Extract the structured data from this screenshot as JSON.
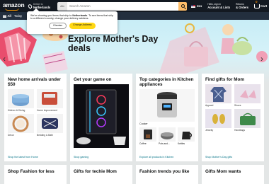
{
  "nav": {
    "logo": "amazon",
    "deliver_line1": "Deliver to",
    "deliver_line2": "Netherlands",
    "search_category": "All",
    "search_placeholder": "Search Amazon",
    "language": "EN",
    "account_line1": "Hello, sign in",
    "account_line2": "Account & Lists",
    "orders_line1": "Returns",
    "orders_line2": "& Orders",
    "cart_count": "0",
    "cart_label": "Cart"
  },
  "subnav": {
    "menu_label": "All",
    "items": [
      "Today"
    ]
  },
  "popup": {
    "message_pre": "We're showing you items that ship to ",
    "country": "Netherlands",
    "message_post": ". To see items that ship to a different country, change your delivery address.",
    "dismiss_label": "Dismiss",
    "change_label": "Change Address"
  },
  "hero": {
    "title": "Explore Mother's Day deals"
  },
  "cards": [
    {
      "title": "New home arrivals under $50",
      "tiles": [
        "Kitchen & Dining",
        "Home Improvement",
        "Décor",
        "Bedding & Bath"
      ],
      "link": "Shop the latest from Home"
    },
    {
      "title": "Get your game on",
      "link": "Shop gaming"
    },
    {
      "title": "Top categories in Kitchen appliances",
      "main_caption": "Cooker",
      "tiles": [
        "Coffee",
        "Pots and...",
        "Kettles"
      ],
      "link": "Explore all products in Kitchen"
    },
    {
      "title": "Find gifts for Mom",
      "tiles": [
        "Apparel",
        "Shoes",
        "Jewelry",
        "Handbags"
      ],
      "link": "Shop Mother's Day gifts"
    }
  ],
  "cards_row2": [
    {
      "title": "Shop Fashion for less"
    },
    {
      "title": "Gifts for techie Mom"
    },
    {
      "title": "Fashion trends you like"
    },
    {
      "title": "Gifts Mom wants"
    }
  ],
  "colors": {
    "nav_bg": "#131921",
    "subnav_bg": "#232f3e",
    "accent": "#ff9900",
    "search_button": "#febd69",
    "link": "#007185",
    "primary_button": "#ffd814"
  }
}
